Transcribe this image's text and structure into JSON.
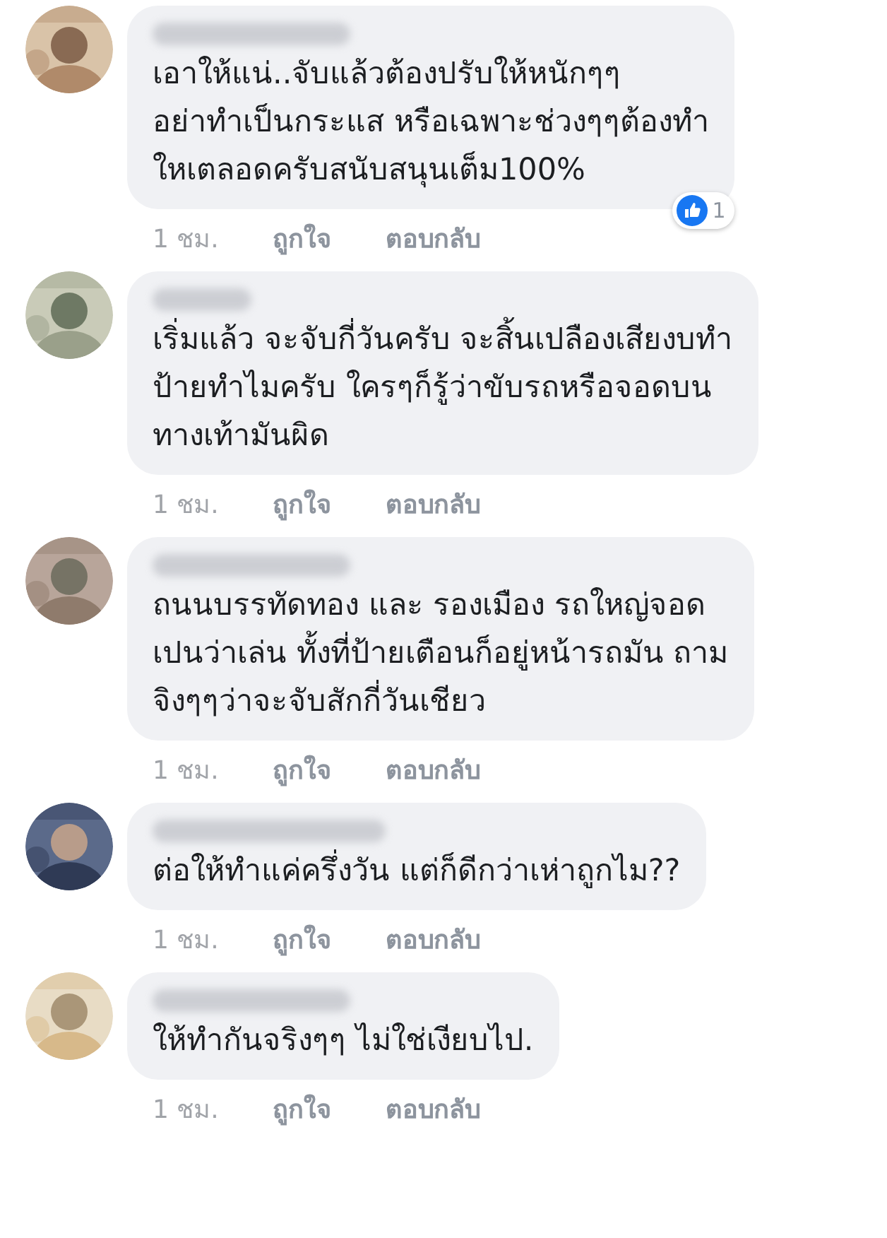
{
  "comments": [
    {
      "text": "เอาให้แน่..จับแล้วต้องปรับให้หนักๆๆ\nอย่าทำเป็นกระแส หรือเฉพาะช่วงๆๆต้องทำ\nใหเตลอดครับสนับสนุนเต็ม100%",
      "reactions": {
        "count": "1"
      },
      "time": "1 ชม.",
      "like": "ถูกใจ",
      "reply": "ตอบกลับ"
    },
    {
      "text": "เริ่มแล้ว จะจับกี่วันครับ จะสิ้นเปลืองเสียงบทำ\nป้ายทำไมครับ ใครๆก็รู้ว่าขับรถหรือจอดบน\nทางเท้ามันผิด",
      "time": "1 ชม.",
      "like": "ถูกใจ",
      "reply": "ตอบกลับ"
    },
    {
      "text": "ถนนบรรทัดทอง และ รองเมือง รถใหญ่จอด\nเปนว่าเล่น ทั้งที่ป้ายเตือนก็อยู่หน้ารถมัน ถาม\nจิงๆๆว่าจะจับสักกี่วันเชียว",
      "time": "1 ชม.",
      "like": "ถูกใจ",
      "reply": "ตอบกลับ"
    },
    {
      "text": "ต่อให้ทำแค่ครึ่งวัน แต่ก็ดีกว่าเห่าถูกไม??",
      "time": "1 ชม.",
      "like": "ถูกใจ",
      "reply": "ตอบกลับ"
    },
    {
      "text": "ให้ทำกันจริงๆๆ ไม่ใช่เงียบไป.",
      "time": "1 ชม.",
      "like": "ถูกใจ",
      "reply": "ตอบกลับ"
    }
  ]
}
